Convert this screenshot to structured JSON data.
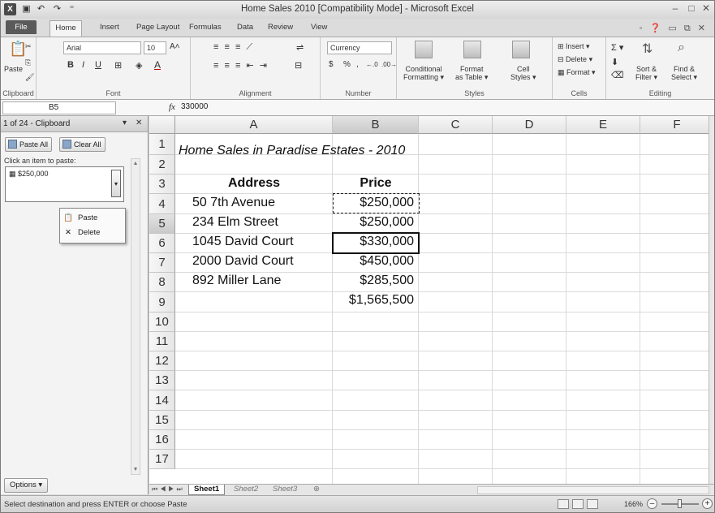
{
  "window": {
    "title": "Home Sales 2010  [Compatibility Mode]  -  Microsoft Excel",
    "controls": [
      "–",
      "□",
      "✕"
    ]
  },
  "ribbon_tabs": [
    "File",
    "Home",
    "Insert",
    "Page Layout",
    "Formulas",
    "Data",
    "Review",
    "View"
  ],
  "ribbon": {
    "clipboard": {
      "paste": "Paste",
      "label": "Clipboard"
    },
    "font": {
      "family": "Arial",
      "size": "10",
      "bold": "B",
      "italic": "I",
      "underline": "U",
      "grow": "A˄",
      "shrink": "A˅",
      "label": "Font"
    },
    "alignment": {
      "label": "Alignment"
    },
    "number": {
      "format": "Currency",
      "dollar": "$",
      "percent": "%",
      "comma": ",",
      "dec_inc": "←.0",
      "dec_dec": ".00→",
      "label": "Number"
    },
    "styles": {
      "conditional": [
        "Conditional",
        "Formatting ▾"
      ],
      "format_table": [
        "Format",
        "as Table ▾"
      ],
      "cell_styles": [
        "Cell",
        "Styles ▾"
      ],
      "label": "Styles"
    },
    "cells": {
      "insert": "Insert ▾",
      "delete": "Delete ▾",
      "format": "Format ▾",
      "label": "Cells"
    },
    "editing": {
      "sigma": "Σ ▾",
      "sort": [
        "Sort &",
        "Filter ▾"
      ],
      "find": [
        "Find &",
        "Select ▾"
      ],
      "label": "Editing"
    }
  },
  "formula_bar": {
    "name_box": "B5",
    "fx": "fx",
    "value": "330000"
  },
  "clipboard_pane": {
    "title": "1 of 24 - Clipboard",
    "paste_all": "Paste All",
    "clear_all": "Clear All",
    "hint": "Click an item to paste:",
    "item": "$250,000",
    "menu": [
      {
        "label": "Paste",
        "icon": "paste-icon"
      },
      {
        "label": "Delete",
        "icon": "delete-x-icon"
      }
    ],
    "options": "Options ▾"
  },
  "sheet": {
    "columns": [
      "A",
      "B",
      "C",
      "D",
      "E",
      "F"
    ],
    "row_numbers": [
      "1",
      "2",
      "3",
      "4",
      "5",
      "6",
      "7",
      "8",
      "9",
      "10",
      "11",
      "12",
      "13",
      "14",
      "15",
      "16",
      "17"
    ],
    "title": "Home Sales in Paradise Estates - 2010",
    "header": {
      "address": "Address",
      "price": "Price"
    },
    "rows": [
      {
        "address": "50 7th Avenue",
        "price": "$250,000"
      },
      {
        "address": "234 Elm Street",
        "price": "$250,000"
      },
      {
        "address": "1045 David Court",
        "price": "$330,000"
      },
      {
        "address": "2000 David Court",
        "price": "$450,000"
      },
      {
        "address": "892 Miller Lane",
        "price": "$285,500"
      }
    ],
    "total": "$1,565,500",
    "active_cell": "B5",
    "copied_cell": "B3"
  },
  "sheet_tabs": [
    "Sheet1",
    "Sheet2",
    "Sheet3"
  ],
  "status_bar": {
    "message": "Select destination and press ENTER or choose Paste",
    "zoom": "166%"
  }
}
